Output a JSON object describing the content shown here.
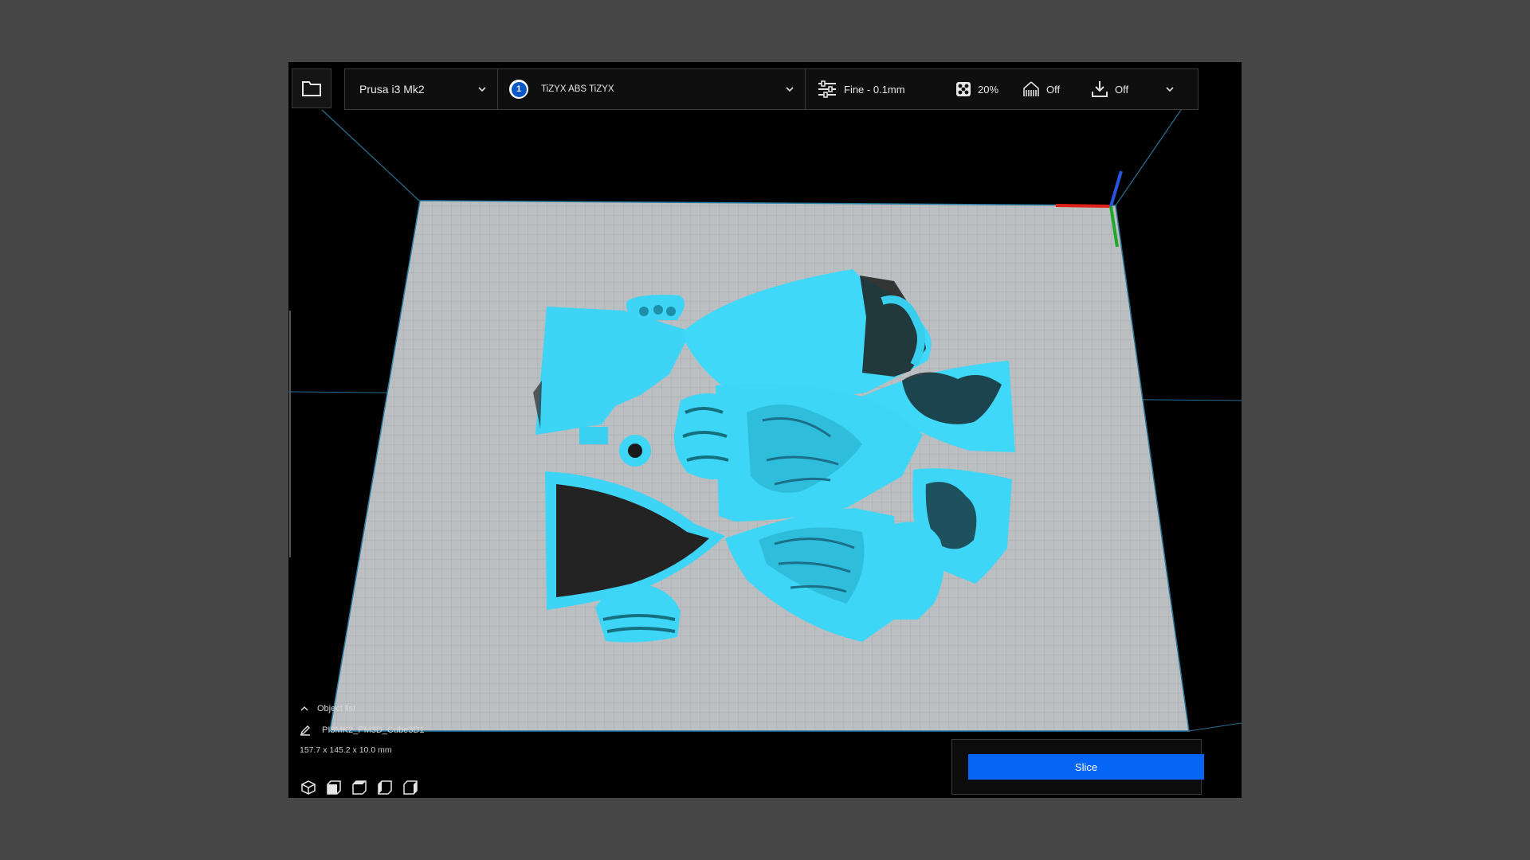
{
  "toolbar": {
    "printer": "Prusa i3 Mk2",
    "material_index": "1",
    "material": "TiZYX ABS TiZYX",
    "profile": "Fine - 0.1mm",
    "infill": "20%",
    "support": "Off",
    "adhesion": "Off"
  },
  "objects": {
    "toggle_label": "Object list",
    "name": "PI3MK2_PM3D_Cube3D1",
    "dimensions": "157.7 x 145.2 x 10.0 mm"
  },
  "slice": {
    "label": "Slice"
  },
  "colors": {
    "model": "#3fd6f7",
    "bed": "#b9bcbf",
    "accent": "#0565f5",
    "background": "#000000"
  },
  "icons": [
    "folder-icon",
    "chevron-down-icon",
    "material-badge",
    "settings-sliders-icon",
    "infill-icon",
    "support-icon",
    "adhesion-icon",
    "view-3d-icon",
    "view-front-icon",
    "view-top-icon",
    "view-left-icon",
    "view-right-icon",
    "pencil-icon",
    "chevron-up-icon"
  ]
}
